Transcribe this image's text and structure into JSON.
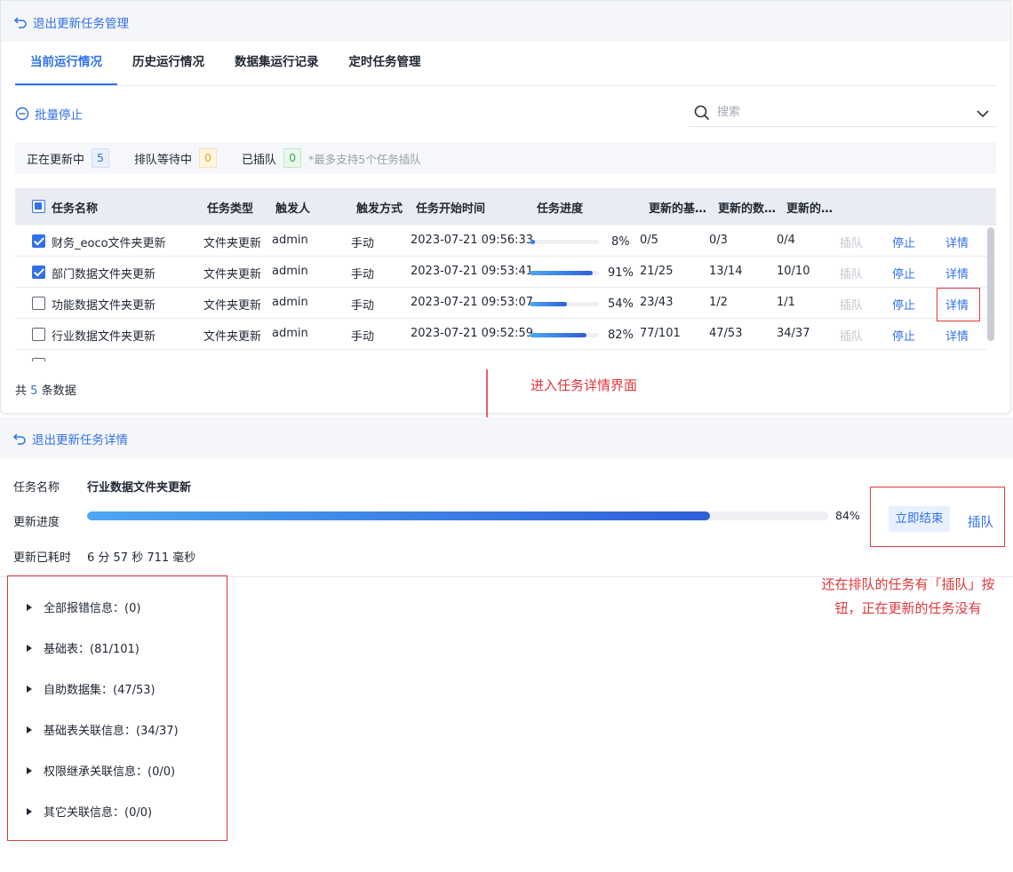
{
  "top": {
    "back_label": "退出更新任务管理",
    "tabs": [
      "当前运行情况",
      "历史运行情况",
      "数据集运行记录",
      "定时任务管理"
    ],
    "batch_stop": "批量停止",
    "search_placeholder": "搜索",
    "status": {
      "updating_label": "正在更新中",
      "updating_count": "5",
      "queued_label": "排队等待中",
      "queued_count": "0",
      "inserted_label": "已插队",
      "inserted_count": "0",
      "note": "*最多支持5个任务插队"
    },
    "columns": [
      "任务名称",
      "任务类型",
      "触发人",
      "触发方式",
      "任务开始时间",
      "任务进度",
      "更新的基…",
      "更新的数…",
      "更新的…"
    ],
    "rows": [
      {
        "name": "财务_eoco文件夹更新",
        "type": "文件夹更新",
        "user": "admin",
        "trigger": "手动",
        "start": "2023-07-21 09:56:33",
        "progress": 8,
        "progress_text": "8%",
        "c1": "0/5",
        "c2": "0/3",
        "c3": "0/4",
        "insert": "插队",
        "stop": "停止",
        "detail": "详情"
      },
      {
        "name": "部门数据文件夹更新",
        "type": "文件夹更新",
        "user": "admin",
        "trigger": "手动",
        "start": "2023-07-21 09:53:41",
        "progress": 91,
        "progress_text": "91%",
        "c1": "21/25",
        "c2": "13/14",
        "c3": "10/10",
        "insert": "插队",
        "stop": "停止",
        "detail": "详情"
      },
      {
        "name": "功能数据文件夹更新",
        "type": "文件夹更新",
        "user": "admin",
        "trigger": "手动",
        "start": "2023-07-21 09:53:07",
        "progress": 54,
        "progress_text": "54%",
        "c1": "23/43",
        "c2": "1/2",
        "c3": "1/1",
        "insert": "插队",
        "stop": "停止",
        "detail": "详情"
      },
      {
        "name": "行业数据文件夹更新",
        "type": "文件夹更新",
        "user": "admin",
        "trigger": "手动",
        "start": "2023-07-21 09:52:59",
        "progress": 82,
        "progress_text": "82%",
        "c1": "77/101",
        "c2": "47/53",
        "c3": "34/37",
        "insert": "插队",
        "stop": "停止",
        "detail": "详情"
      }
    ],
    "total_prefix": "共",
    "total_count": "5",
    "total_suffix": "条数据"
  },
  "annotation_top": "进入任务详情界面",
  "detail": {
    "back_label": "退出更新任务详情",
    "name_label": "任务名称",
    "name_value": "行业数据文件夹更新",
    "progress_label": "更新进度",
    "progress": 84,
    "progress_text": "84%",
    "end_button": "立即结束",
    "insert_button": "插队",
    "elapsed_label": "更新已耗时",
    "elapsed_value": "6 分 57 秒 711 毫秒",
    "groups": [
      "全部报错信息：(0)",
      "基础表：(81/101)",
      "自助数据集：(47/53)",
      "基础表关联信息：(34/37)",
      "权限继承关联信息：(0/0)",
      "其它关联信息：(0/0)"
    ]
  },
  "annotation_right_line1": "还在排队的任务有「插队」按",
  "annotation_right_line2": "钮，正在更新的任务没有"
}
